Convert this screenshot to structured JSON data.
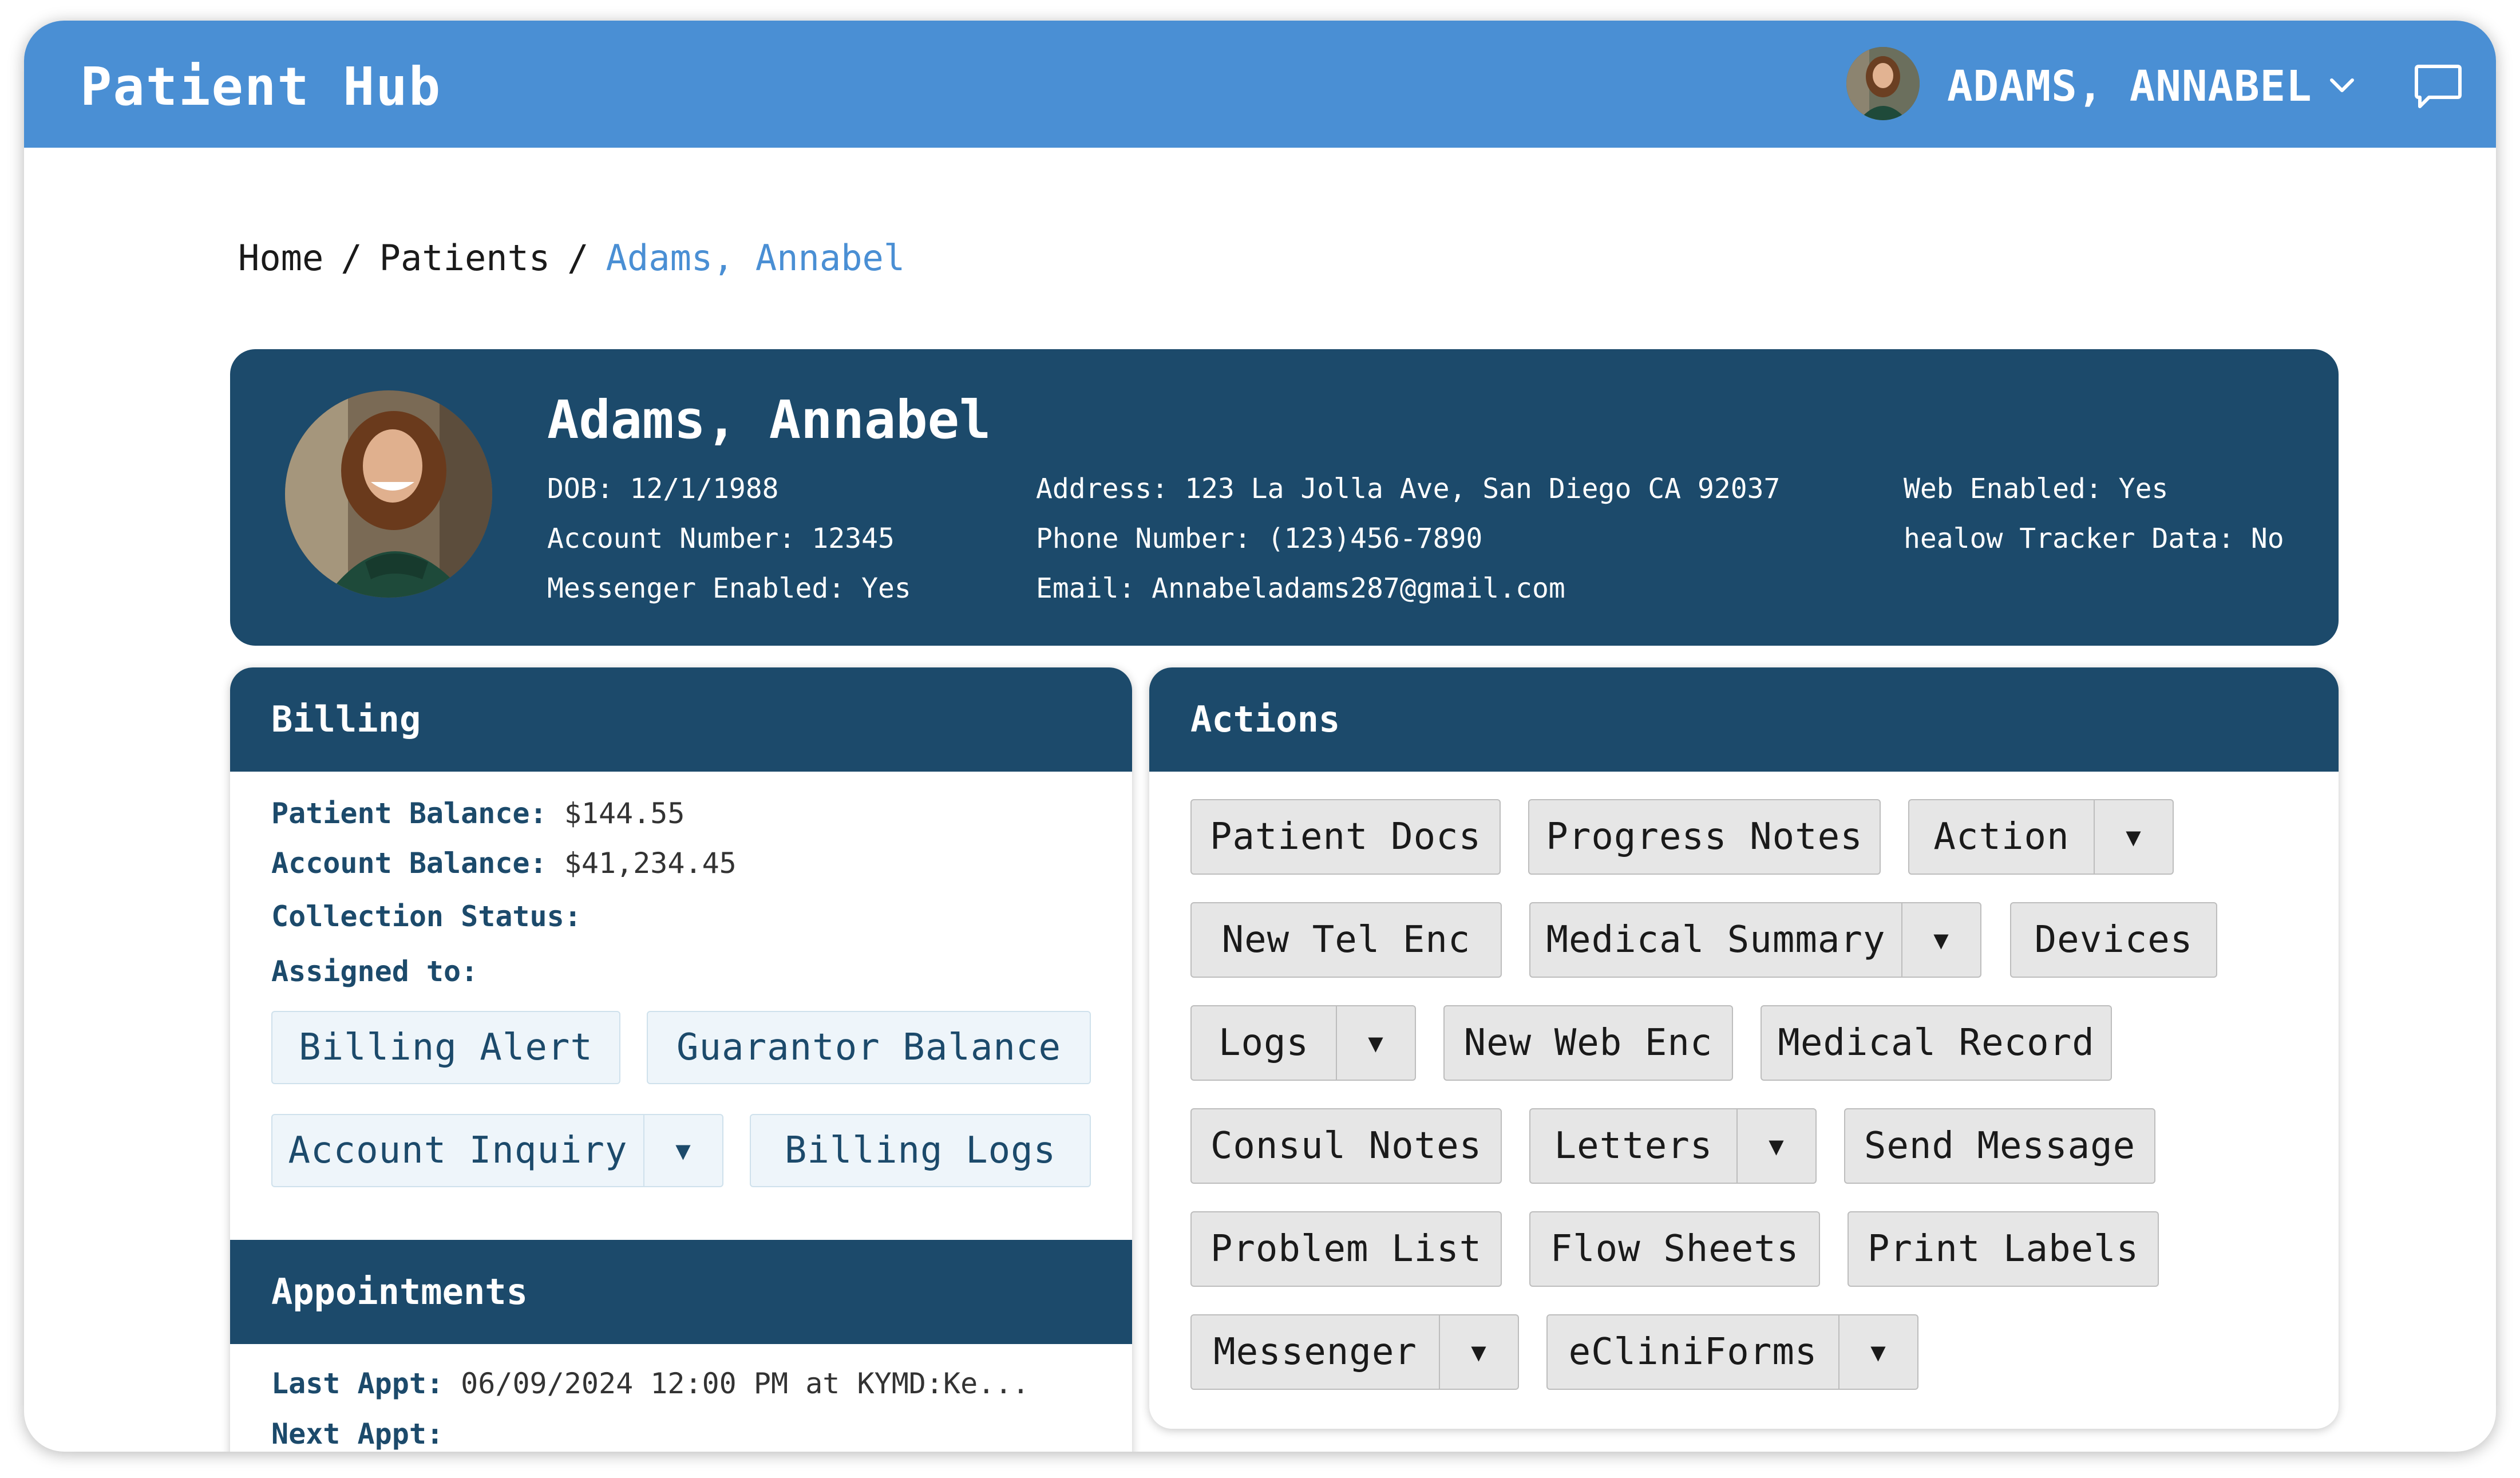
{
  "app": {
    "title": "Patient Hub"
  },
  "user": {
    "name": "ADAMS, ANNABEL"
  },
  "breadcrumb": {
    "home": "Home",
    "sep": "/",
    "patients": "Patients",
    "current": "Adams, Annabel"
  },
  "patient": {
    "name": "Adams, Annabel",
    "dob": "DOB: 12/1/1988",
    "account_number": "Account Number: 12345",
    "messenger_enabled": "Messenger Enabled: Yes",
    "address": "Address: 123 La Jolla Ave, San Diego CA 92037",
    "phone": "Phone Number: (123)456-7890",
    "email": "Email: Annabeladams287@gmail.com",
    "web_enabled": "Web Enabled: Yes",
    "tracker": "healow Tracker Data: No"
  },
  "billing": {
    "title": "Billing",
    "patient_balance_label": "Patient Balance:",
    "patient_balance": "$144.55",
    "account_balance_label": "Account Balance:",
    "account_balance": "$41,234.45",
    "collection_status_label": "Collection Status:",
    "assigned_to_label": "Assigned to:",
    "buttons": {
      "billing_alert": "Billing Alert",
      "guarantor_balance": "Guarantor Balance",
      "account_inquiry": "Account Inquiry",
      "billing_logs": "Billing Logs"
    }
  },
  "appointments": {
    "title": "Appointments",
    "last_label": "Last Appt:",
    "last_value": "06/09/2024 12:00 PM at KYMD:Ke...",
    "next_label": "Next Appt:"
  },
  "actions": {
    "title": "Actions",
    "patient_docs": "Patient Docs",
    "progress_notes": "Progress Notes",
    "action": "Action",
    "new_tel_enc": "New Tel Enc",
    "medical_summary": "Medical Summary",
    "devices": "Devices",
    "logs": "Logs",
    "new_web_enc": "New Web Enc",
    "medical_record": "Medical Record",
    "consul_notes": "Consul Notes",
    "letters": "Letters",
    "send_message": "Send Message",
    "problem_list": "Problem List",
    "flow_sheets": "Flow Sheets",
    "print_labels": "Print Labels",
    "messenger": "Messenger",
    "ecliniforms": "eCliniForms"
  },
  "caret_glyph": "▼",
  "colors": {
    "brand": "#4a8fd4",
    "navy": "#1c4a6b",
    "button_grey": "#e6e6e6",
    "button_light": "#eef5fa"
  }
}
